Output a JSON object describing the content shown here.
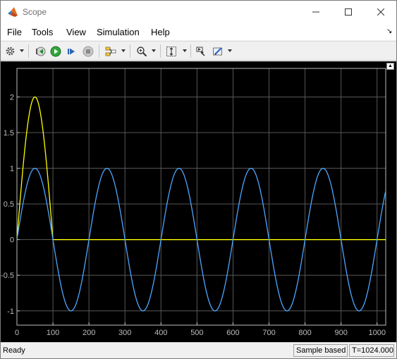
{
  "window": {
    "title": "Scope"
  },
  "menu": [
    "File",
    "Tools",
    "View",
    "Simulation",
    "Help"
  ],
  "toolbar": {
    "icons": [
      "gear-icon",
      "step-back-icon",
      "run-icon",
      "step-forward-icon",
      "stop-icon",
      "signal-select-icon",
      "zoom-icon",
      "autoscale-icon",
      "highlight-simulink-block-icon",
      "style-icon"
    ]
  },
  "status": {
    "ready": "Ready",
    "mode": "Sample based",
    "time": "T=1024.000"
  },
  "colors": {
    "background": "#000000",
    "grid": "#575757",
    "ticks": "#bdbdbd",
    "series_yellow": "#ffff00",
    "series_blue": "#4da6ff"
  },
  "chart_data": {
    "type": "line",
    "title": "",
    "xlabel": "",
    "ylabel": "",
    "xlim": [
      0,
      1024
    ],
    "ylim": [
      -1.2,
      2.4
    ],
    "xticks": [
      0,
      100,
      200,
      300,
      400,
      500,
      600,
      700,
      800,
      900,
      1000
    ],
    "yticks": [
      2,
      1.5,
      1,
      0.5,
      0,
      -0.5,
      -1
    ],
    "ytick_labels": [
      "2",
      "1.5",
      "1",
      "0.5",
      "0",
      "-0.5",
      "-1"
    ],
    "grid": true,
    "series": [
      {
        "color": "#ffff00",
        "x": [
          0,
          10,
          20,
          30,
          40,
          50,
          60,
          70,
          80,
          90,
          100,
          150,
          200,
          300,
          400,
          500,
          600,
          700,
          800,
          900,
          1024
        ],
        "y": [
          0,
          0.62,
          1.18,
          1.62,
          1.9,
          2,
          1.9,
          1.62,
          1.18,
          0.62,
          0,
          0,
          0,
          0,
          0,
          0,
          0,
          0,
          0,
          0,
          0
        ]
      },
      {
        "color": "#4da6ff",
        "function": "sine",
        "amplitude": 1,
        "period": 200,
        "x_range": [
          0,
          1024
        ]
      }
    ]
  }
}
